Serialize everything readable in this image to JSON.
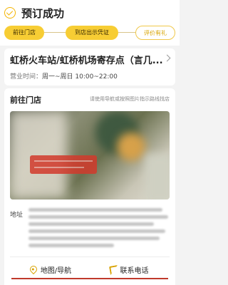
{
  "header": {
    "title": "预订成功",
    "steps": [
      "前往门店",
      "到店出示凭证",
      "评价有礼"
    ]
  },
  "store": {
    "name": "虹桥火车站/虹桥机场寄存点（言几...",
    "hours_label": "营业时间：",
    "hours_value": "周一~周日 10:00~22:00"
  },
  "directions": {
    "title": "前往门店",
    "hint": "请使用导航或按照图片指示路线找店",
    "address_label": "地址"
  },
  "actions": {
    "map_label": "地图/导航",
    "call_label": "联系电话"
  },
  "colors": {
    "accent": "#f7cd34",
    "underline": "#c0392b"
  },
  "icons": {
    "success": "check-circle-icon",
    "store_arrow": "chevron-right-icon",
    "map": "map-pin-icon",
    "call": "phone-icon"
  }
}
